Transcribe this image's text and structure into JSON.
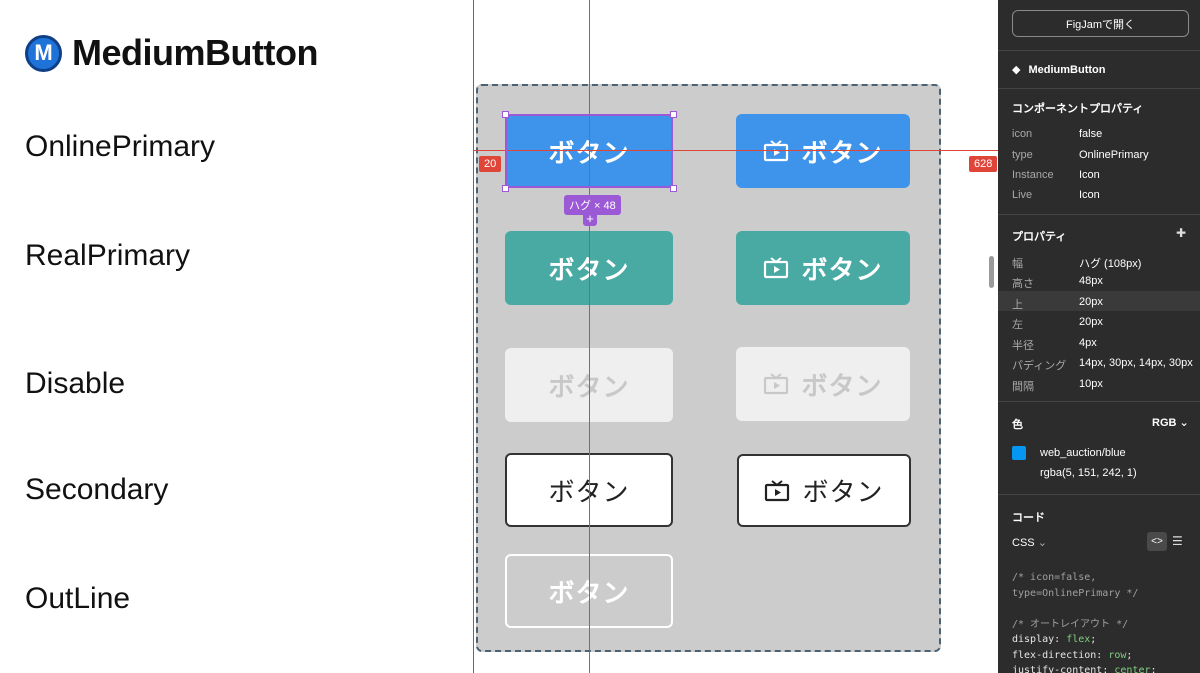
{
  "header": {
    "logo_letter": "M",
    "title": "MediumButton"
  },
  "variants": [
    "OnlinePrimary",
    "RealPrimary",
    "Disable",
    "Secondary",
    "OutLine"
  ],
  "canvas": {
    "button_label": "ボタン",
    "hug_tag": "ハグ × 48",
    "plus": "+",
    "measure_left": "20",
    "measure_right": "628",
    "icon_name": "tv-icon"
  },
  "panel": {
    "open_button": "FigJamで開く",
    "component_name": "MediumButton",
    "component_props_title": "コンポーネントプロパティ",
    "component_props": [
      {
        "key": "icon",
        "value": "false"
      },
      {
        "key": "type",
        "value": "OnlinePrimary"
      },
      {
        "key": "Instance",
        "value": "Icon"
      },
      {
        "key": "Live",
        "value": "Icon"
      }
    ],
    "props_title": "プロパティ",
    "props": [
      {
        "key": "幅",
        "value": "ハグ (108px)"
      },
      {
        "key": "高さ",
        "value": "48px"
      },
      {
        "key": "上",
        "value": "20px"
      },
      {
        "key": "左",
        "value": "20px"
      },
      {
        "key": "半径",
        "value": "4px"
      },
      {
        "key": "パディング",
        "value": "14px, 30px, 14px, 30px"
      },
      {
        "key": "間隔",
        "value": "10px"
      }
    ],
    "color_title": "色",
    "color_mode": "RGB",
    "color_name": "web_auction/blue",
    "color_value": "rgba(5, 151, 242, 1)",
    "swatch_hex": "#0597f2",
    "code_title": "コード",
    "code_lang": "CSS",
    "code_lines": {
      "c1": "/* icon=false,",
      "c2": "type=OnlinePrimary */",
      "c3": "/* オートレイアウト */",
      "p1": "display",
      "v1": "flex",
      "p2": "flex-direction",
      "v2": "row",
      "p3": "justify-content",
      "v3": "center"
    }
  },
  "colors": {
    "online_primary": "#3e94ea",
    "real_primary": "#49aaa4",
    "disable_bg": "#efefef",
    "guide": "#e0453a",
    "selection": "#9b59d6"
  }
}
